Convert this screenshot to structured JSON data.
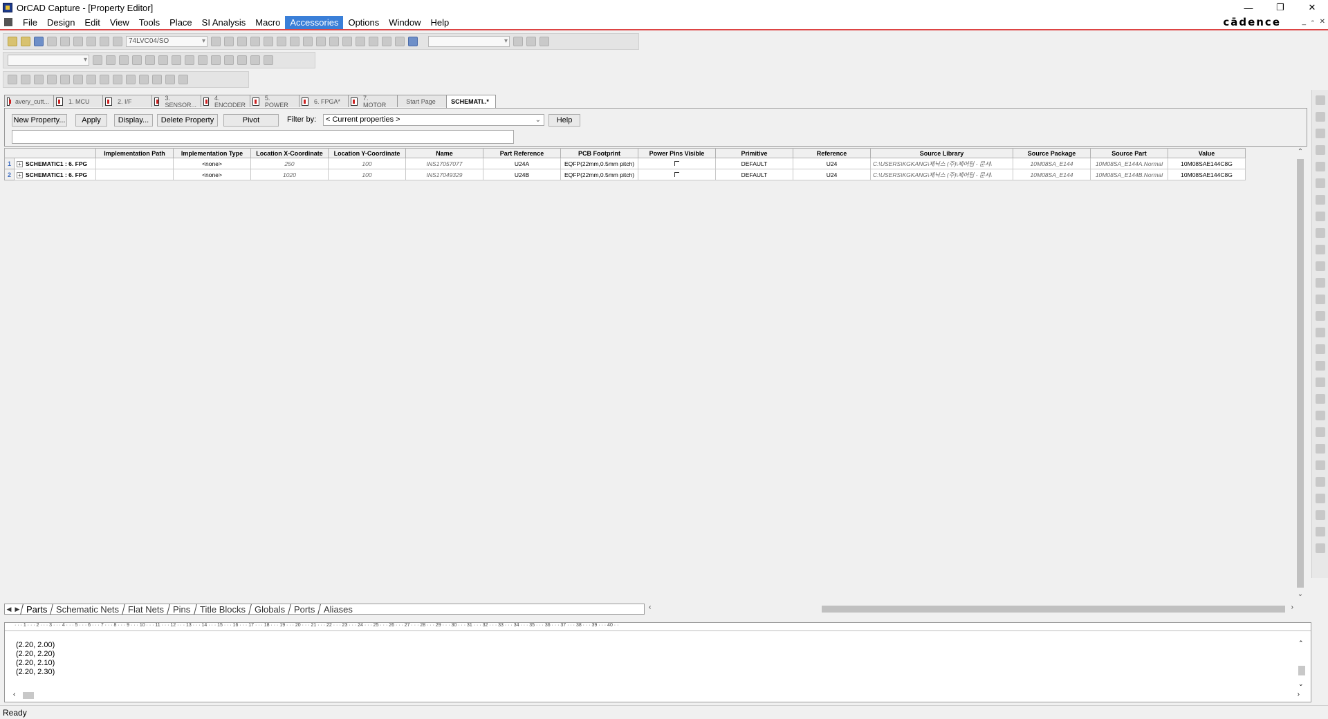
{
  "window": {
    "title": "OrCAD Capture - [Property Editor]",
    "brand": "cādence"
  },
  "menu": [
    "File",
    "Design",
    "Edit",
    "View",
    "Tools",
    "Place",
    "SI Analysis",
    "Macro",
    "Accessories",
    "Options",
    "Window",
    "Help"
  ],
  "menu_active": "Accessories",
  "toolbar": {
    "part_combo": "74LVC04/SO"
  },
  "doc_tabs": [
    "avery_cutt...",
    "1. MCU",
    "2. I/F",
    "3. SENSOR...",
    "4. ENCODER",
    "5. POWER",
    "6. FPGA*",
    "7. MOTOR",
    "Start Page",
    "SCHEMATI..*"
  ],
  "editor": {
    "new_property": "New Property...",
    "apply": "Apply",
    "display": "Display...",
    "delete_property": "Delete Property",
    "pivot": "Pivot",
    "filter_label": "Filter by:",
    "filter_value": "< Current properties >",
    "help": "Help"
  },
  "grid": {
    "columns": [
      "Implementation Path",
      "Implementation Type",
      "Location X-Coordinate",
      "Location Y-Coordinate",
      "Name",
      "Part Reference",
      "PCB Footprint",
      "Power Pins Visible",
      "Primitive",
      "Reference",
      "Source Library",
      "Source Package",
      "Source Part",
      "Value"
    ],
    "rows": [
      {
        "num": "1",
        "head": "SCHEMATIC1 : 6. FPG",
        "impl_path": "",
        "impl_type": "<none>",
        "x": "250",
        "y": "100",
        "name": "INS17057077",
        "part_ref": "U24A",
        "footprint": "EQFP(22mm,0.5mm pitch)",
        "primitive": "DEFAULT",
        "reference": "U24",
        "source_library": "C:\\USERS\\KGKANG\\제닉스 (주)\\제어팀 - 문서\\",
        "source_package": "10M08SA_E144",
        "source_part": "10M08SA_E144A.Normal",
        "value": "10M08SAE144C8G"
      },
      {
        "num": "2",
        "head": "SCHEMATIC1 : 6. FPG",
        "impl_path": "",
        "impl_type": "<none>",
        "x": "1020",
        "y": "100",
        "name": "INS17049329",
        "part_ref": "U24B",
        "footprint": "EQFP(22mm,0.5mm pitch)",
        "primitive": "DEFAULT",
        "reference": "U24",
        "source_library": "C:\\USERS\\KGKANG\\제닉스 (주)\\제어팀 - 문서\\",
        "source_package": "10M08SA_E144",
        "source_part": "10M08SA_E144B.Normal",
        "value": "10M08SAE144C8G"
      }
    ]
  },
  "sheet_tabs": [
    "Parts",
    "Schematic Nets",
    "Flat Nets",
    "Pins",
    "Title Blocks",
    "Globals",
    "Ports",
    "Aliases"
  ],
  "log_lines": [
    "(2.20, 2.00)",
    "(2.20, 2.20)",
    "(2.20, 2.10)",
    "(2.20, 2.30)"
  ],
  "status": "Ready"
}
